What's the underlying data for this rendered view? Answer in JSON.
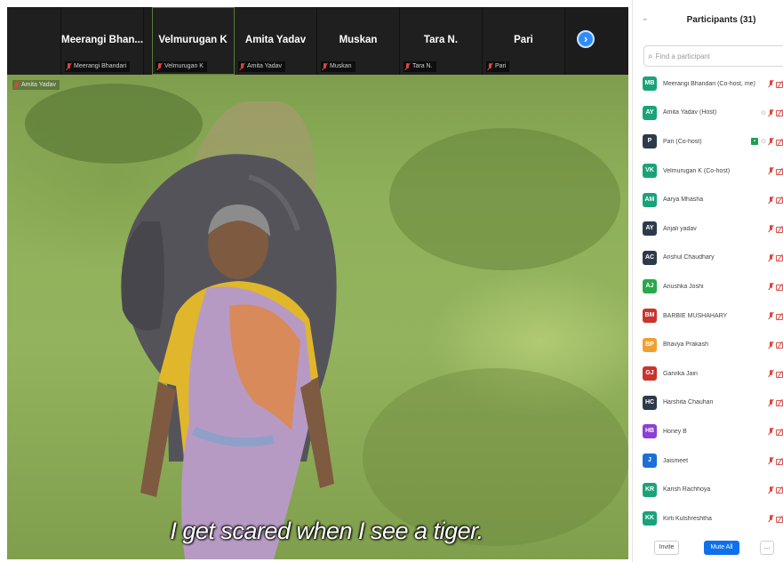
{
  "filmstrip": {
    "tiles": [
      {
        "name": "",
        "label": ""
      },
      {
        "name": "Meerangi Bhan...",
        "label": "Meerangi Bhandari"
      },
      {
        "name": "Velmurugan K",
        "label": "Velmurugan K"
      },
      {
        "name": "Amita Yadav",
        "label": "Amita Yadav"
      },
      {
        "name": "Muskan",
        "label": "Muskan"
      },
      {
        "name": "Tara N.",
        "label": "Tara N."
      },
      {
        "name": "Pari",
        "label": "Pari"
      }
    ],
    "next_icon": "chevron-right-icon"
  },
  "video": {
    "speaker_label": "Amita Yadav",
    "caption": "I get scared when I see a tiger."
  },
  "panel": {
    "collapse_icon": "chevron-down-icon",
    "title": "Participants (31)",
    "search_placeholder": "Find a participant"
  },
  "participants": [
    {
      "initials": "MB",
      "name": "Meerangi Bhandari (Co-host, me)",
      "color": "#1aa37a",
      "extra": ""
    },
    {
      "initials": "AY",
      "name": "Amita Yadav (Host)",
      "color": "#1aa37a",
      "extra": "host"
    },
    {
      "initials": "P",
      "name": "Pari (Co-host)",
      "color": "#2d3a4a",
      "extra": "share"
    },
    {
      "initials": "VK",
      "name": "Velmurugan K (Co-host)",
      "color": "#1aa37a",
      "extra": ""
    },
    {
      "initials": "AM",
      "name": "Aarya Mhasha",
      "color": "#1aa37a",
      "extra": ""
    },
    {
      "initials": "AY",
      "name": "Anjali yadav",
      "color": "#2d3a4a",
      "extra": ""
    },
    {
      "initials": "AC",
      "name": "Anshul Chaudhary",
      "color": "#2d3a4a",
      "extra": ""
    },
    {
      "initials": "AJ",
      "name": "Anushka Joshi",
      "color": "#2aa84a",
      "extra": ""
    },
    {
      "initials": "BM",
      "name": "BARBIE MUSHAHARY",
      "color": "#c9342f",
      "extra": ""
    },
    {
      "initials": "BP",
      "name": "Bhavya Prakash",
      "color": "#f0a030",
      "extra": ""
    },
    {
      "initials": "GJ",
      "name": "Garvika Jain",
      "color": "#c9342f",
      "extra": ""
    },
    {
      "initials": "HC",
      "name": "Harshita Chauhan",
      "color": "#2d3a4a",
      "extra": ""
    },
    {
      "initials": "HB",
      "name": "Honey B",
      "color": "#8c3fd6",
      "extra": ""
    },
    {
      "initials": "J",
      "name": "Jaismeet",
      "color": "#1d6fd6",
      "extra": ""
    },
    {
      "initials": "KR",
      "name": "Karish Rachhoya",
      "color": "#1aa37a",
      "extra": ""
    },
    {
      "initials": "KK",
      "name": "Kirti Kulshreshtha",
      "color": "#1aa37a",
      "extra": ""
    }
  ],
  "footer": {
    "invite_label": "Invite",
    "mute_all_label": "Mute All",
    "more_label": "..."
  }
}
